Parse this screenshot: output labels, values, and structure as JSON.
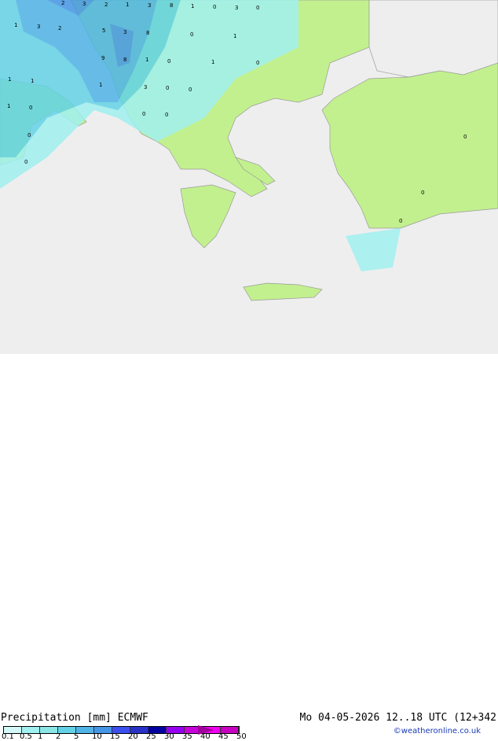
{
  "title": "Precipitation [mm]",
  "model": "ECMWF",
  "datetime": "Mo 04-05-2026 12..18 UTC (12+342",
  "copyright": "©weatheronline.co.uk",
  "legend": {
    "ticks": [
      "0.1",
      "0.5",
      "1",
      "2",
      "5",
      "10",
      "15",
      "20",
      "25",
      "30",
      "35",
      "40",
      "45",
      "50"
    ],
    "colors": [
      "#d4f8f8",
      "#a0f0f0",
      "#8ce6e6",
      "#64d2e6",
      "#50b4e6",
      "#4696e6",
      "#3c50f0",
      "#2832c8",
      "#0000a0",
      "#9600f0",
      "#c800dc",
      "#f000f0",
      "#c800c0"
    ]
  },
  "map_values": [
    "2",
    "3",
    "2",
    "1",
    "3",
    "8",
    "1",
    "0",
    "3",
    "0",
    "1",
    "3",
    "2",
    "5",
    "3",
    "8",
    "0",
    "1",
    "9",
    "8",
    "1",
    "0",
    "1",
    "0",
    "1",
    "1",
    "1",
    "3",
    "0",
    "0",
    "1",
    "0",
    "0",
    "0",
    "0",
    "0",
    "0",
    "0",
    "0"
  ],
  "colors": {
    "sea": "#eeeeee",
    "land": "#c2f08e",
    "coast": "#999999"
  }
}
